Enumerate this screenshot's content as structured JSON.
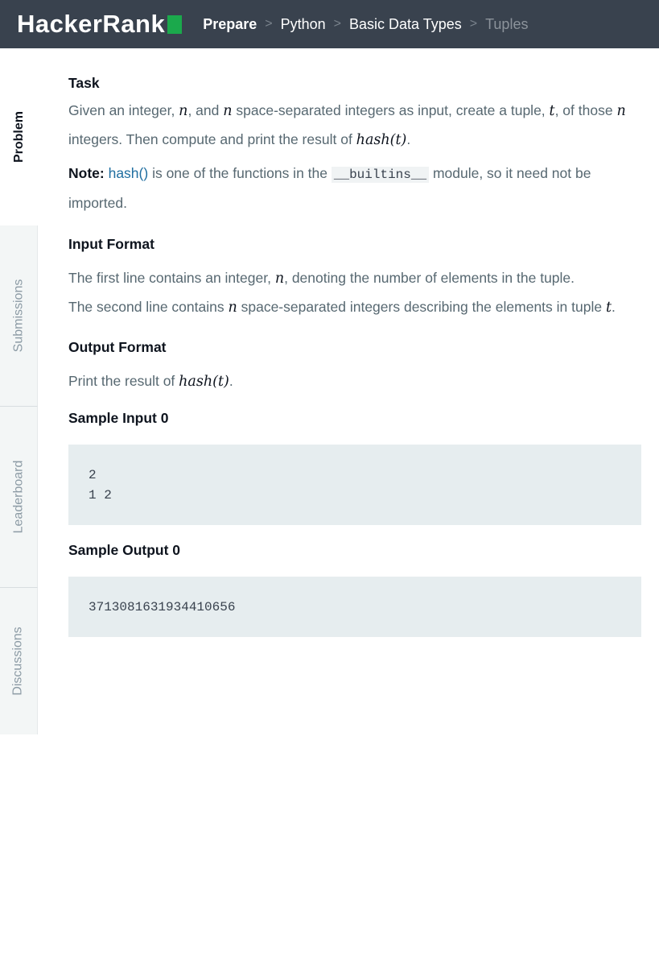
{
  "header": {
    "logo": "HackerRank",
    "breadcrumb": [
      "Prepare",
      "Python",
      "Basic Data Types",
      "Tuples"
    ],
    "separator": ">"
  },
  "sidebar": {
    "tabs": [
      "Problem",
      "Submissions",
      "Leaderboard",
      "Discussions"
    ]
  },
  "content": {
    "task_title": "Task",
    "task": [
      "Given an integer, ",
      "n",
      ", and ",
      "n",
      " space-separated integers as input, create a tuple, ",
      "t",
      ", of those ",
      "n",
      " integers. Then compute and print the result of ",
      "hash(t)",
      "."
    ],
    "note_label": "Note:",
    "note_link": "hash()",
    "note_a": " is one of the functions in the ",
    "note_code": "__builtins__",
    "note_b": " module, so it need not be imported.",
    "input_title": "Input Format",
    "input1": [
      "The first line contains an integer, ",
      "n",
      ", denoting the number of elements in the tuple."
    ],
    "input2": [
      "The second line contains ",
      "n",
      " space-separated integers describing the elements in tuple ",
      "t",
      "."
    ],
    "output_title": "Output Format",
    "output": [
      "Print the result of ",
      "hash(t)",
      "."
    ],
    "sample_input_title": "Sample Input 0",
    "sample_input": "2\n1 2",
    "sample_output_title": "Sample Output 0",
    "sample_output": "3713081631934410656"
  }
}
